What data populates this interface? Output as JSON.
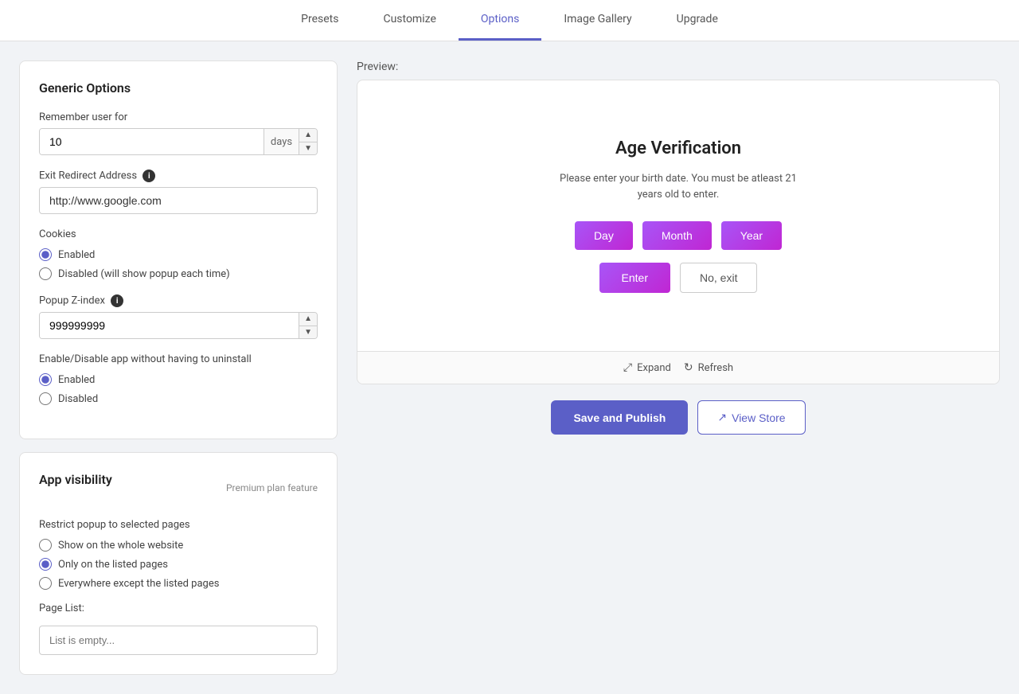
{
  "nav": {
    "tabs": [
      {
        "id": "presets",
        "label": "Presets",
        "active": false
      },
      {
        "id": "customize",
        "label": "Customize",
        "active": false
      },
      {
        "id": "options",
        "label": "Options",
        "active": true
      },
      {
        "id": "image-gallery",
        "label": "Image Gallery",
        "active": false
      },
      {
        "id": "upgrade",
        "label": "Upgrade",
        "active": false
      }
    ]
  },
  "generic_options": {
    "title": "Generic Options",
    "remember_user_label": "Remember user for",
    "remember_user_value": "10",
    "remember_user_unit": "days",
    "exit_redirect_label": "Exit Redirect Address",
    "exit_redirect_info": "i",
    "exit_redirect_value": "http://www.google.com",
    "cookies_label": "Cookies",
    "cookies_options": [
      {
        "id": "enabled",
        "label": "Enabled",
        "checked": true
      },
      {
        "id": "disabled",
        "label": "Disabled (will show popup each time)",
        "checked": false
      }
    ],
    "popup_zindex_label": "Popup Z-index",
    "popup_zindex_info": "i",
    "popup_zindex_value": "999999999",
    "enable_disable_label": "Enable/Disable app without having to uninstall",
    "enable_disable_options": [
      {
        "id": "ed-enabled",
        "label": "Enabled",
        "checked": true
      },
      {
        "id": "ed-disabled",
        "label": "Disabled",
        "checked": false
      }
    ]
  },
  "app_visibility": {
    "title": "App visibility",
    "premium_label": "Premium plan feature",
    "restrict_label": "Restrict popup to selected pages",
    "visibility_options": [
      {
        "id": "whole-website",
        "label": "Show on the whole website",
        "checked": false
      },
      {
        "id": "listed-pages",
        "label": "Only on the listed pages",
        "checked": true
      },
      {
        "id": "except-pages",
        "label": "Everywhere except the listed pages",
        "checked": false
      }
    ],
    "page_list_label": "Page List:",
    "page_list_placeholder": "List is empty..."
  },
  "preview": {
    "label": "Preview:",
    "age_verification_title": "Age Verification",
    "age_desc": "Please enter your birth date. You must be atleast 21 years old to enter.",
    "day_btn": "Day",
    "month_btn": "Month",
    "year_btn": "Year",
    "enter_btn": "Enter",
    "no_exit_btn": "No, exit",
    "expand_label": "Expand",
    "refresh_label": "Refresh"
  },
  "actions": {
    "save_publish": "Save and Publish",
    "view_store": "View Store"
  }
}
